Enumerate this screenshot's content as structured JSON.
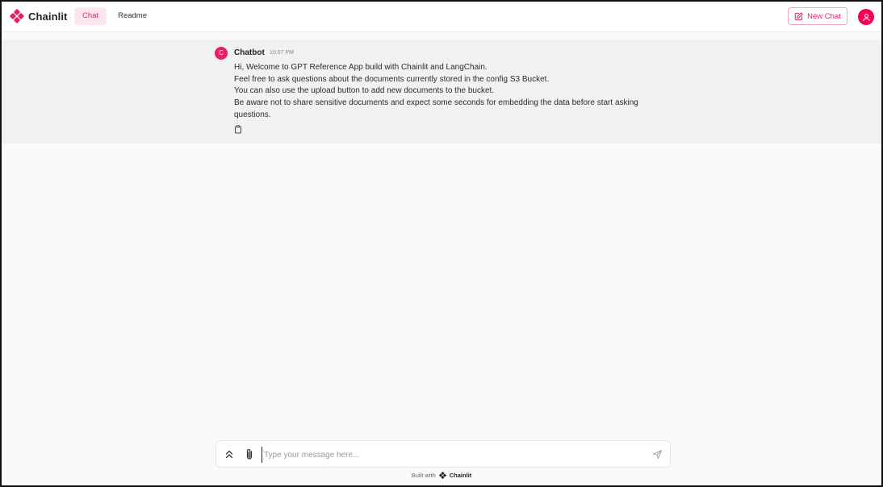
{
  "header": {
    "brand_name": "Chainlit",
    "tabs": [
      {
        "label": "Chat",
        "active": true
      },
      {
        "label": "Readme",
        "active": false
      }
    ],
    "new_chat_label": "New Chat",
    "icons": {
      "logo": "chainlit-logo-icon",
      "new_chat": "edit-icon",
      "avatar": "user-icon"
    }
  },
  "message": {
    "avatar_letter": "C",
    "author": "Chatbot",
    "time": "10:07 PM",
    "lines": [
      "Hi, Welcome to GPT Reference App build with Chainlit and LangChain.",
      "Feel free to ask questions about the documents currently stored in the config S3 Bucket.",
      "You can also use the upload button to add new documents to the bucket.",
      "Be aware not to share sensitive documents and expect some seconds for embedding the data before start asking",
      "questions."
    ],
    "icons": {
      "copy": "clipboard-icon"
    }
  },
  "composer": {
    "placeholder": "Type your message here...",
    "value": "",
    "icons": {
      "settings": "chevron-double-up-icon",
      "attach": "paperclip-icon",
      "send": "send-icon"
    }
  },
  "footer": {
    "built_with": "Built with",
    "brand": "Chainlit"
  },
  "colors": {
    "accent": "#e91e63",
    "accent_light": "#fde6ec",
    "message_bg": "#f1f1f1",
    "page_bg": "#fafafa"
  }
}
